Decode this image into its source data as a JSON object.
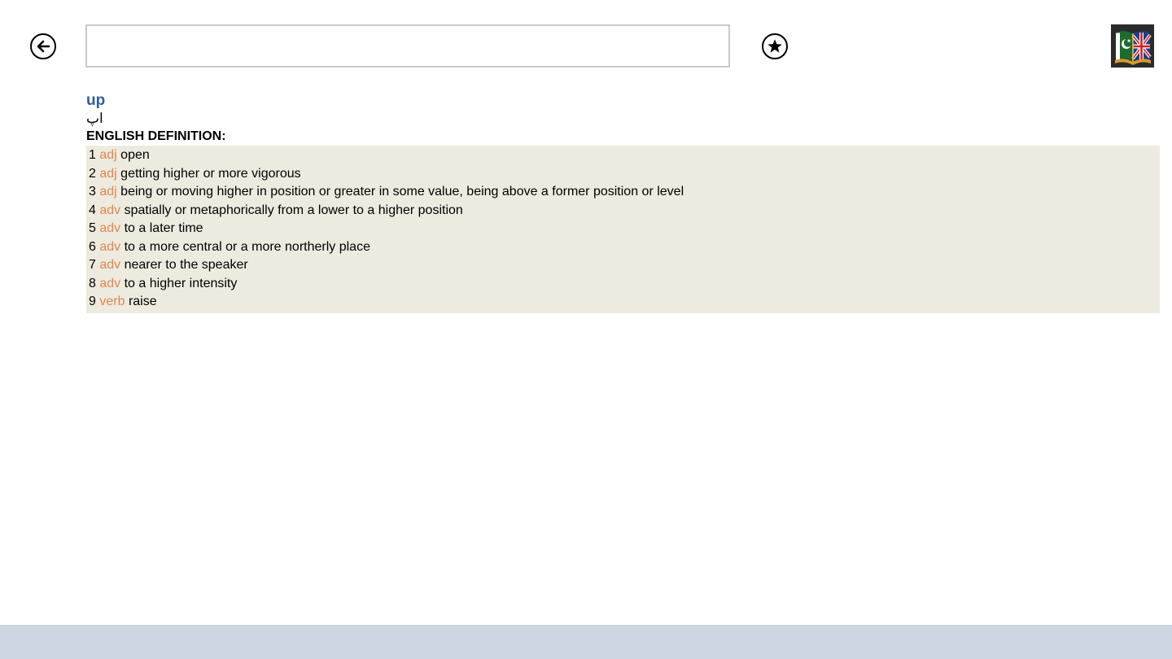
{
  "toolbar": {
    "back_icon": "arrow-left-circle-icon",
    "favorite_icon": "star-circle-icon",
    "search": {
      "value": "",
      "placeholder": ""
    },
    "logo_icon": "urdu-english-book-icon"
  },
  "entry": {
    "word": "up",
    "translation": "اپ",
    "definition_heading": "ENGLISH DEFINITION:",
    "definitions": [
      {
        "num": "1",
        "pos": "adj",
        "text": "open"
      },
      {
        "num": "2",
        "pos": "adj",
        "text": "getting higher or more vigorous"
      },
      {
        "num": "3",
        "pos": "adj",
        "text": "being or moving higher in position or greater in some value, being above a former position or level"
      },
      {
        "num": "4",
        "pos": "adv",
        "text": "spatially or metaphorically from a lower to a higher position"
      },
      {
        "num": "5",
        "pos": "adv",
        "text": "to a later time"
      },
      {
        "num": "6",
        "pos": "adv",
        "text": "to a more central or a more northerly place"
      },
      {
        "num": "7",
        "pos": "adv",
        "text": "nearer to the speaker"
      },
      {
        "num": "8",
        "pos": "adv",
        "text": "to a higher intensity"
      },
      {
        "num": "9",
        "pos": "verb",
        "text": "raise"
      }
    ]
  },
  "colors": {
    "word": "#2e6096",
    "pos": "#e0884a",
    "definition_background": "#edeae0",
    "bottom_bar": "#cdd6e3"
  }
}
